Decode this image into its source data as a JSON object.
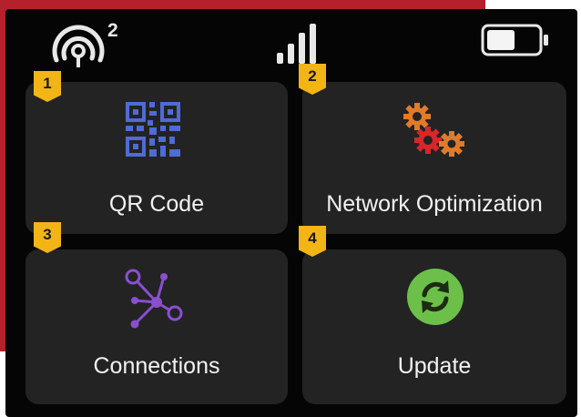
{
  "status_bar": {
    "wifi_connected_count": "2",
    "signal_bars": 4,
    "battery_level": 0.55
  },
  "tiles": [
    {
      "number": "1",
      "label": "QR Code",
      "icon": "qr-code-icon",
      "icon_color": "#4e6bd6"
    },
    {
      "number": "2",
      "label": "Network Optimization",
      "icon": "gears-icon",
      "icon_color": "#e07b2a"
    },
    {
      "number": "3",
      "label": "Connections",
      "icon": "network-nodes-icon",
      "icon_color": "#8a4fd0"
    },
    {
      "number": "4",
      "label": "Update",
      "icon": "refresh-icon",
      "icon_color": "#6cc04a"
    }
  ],
  "colors": {
    "badge": "#f3b516",
    "tile_background": "#232323",
    "screen_background": "#050505",
    "accent_red": "#b5202b"
  }
}
